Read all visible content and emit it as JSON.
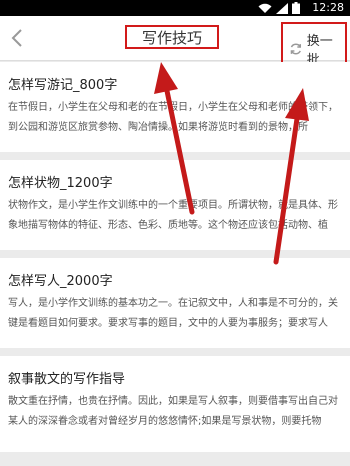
{
  "status": {
    "time": "12:28"
  },
  "header": {
    "title": "写作技巧",
    "refresh_label": "换一批"
  },
  "articles": [
    {
      "title": "怎样写游记_800字",
      "desc": "在节假日，小学生在父母和老的在节假日，小学生在父母和老师的带领下，到公园和游览区旅赏参物、陶冶情操。如果将游览时看到的景物，所"
    },
    {
      "title": "怎样状物_1200字",
      "desc": "状物作文，是小学生作文训练中的一个重要项目。所谓状物，就是具体、形象地描写物体的特征、形态、色彩、质地等。这个物还应该包括动物、植"
    },
    {
      "title": "怎样写人_2000字",
      "desc": "写人，是小学作文训练的基本功之一。在记叙文中，人和事是不可分的，关键是看题目如何要求。要求写事的题目，文中的人要为事服务；要求写人"
    },
    {
      "title": "叙事散文的写作指导",
      "desc": "散文重在抒情，也贵在抒情。因此，如果是写人叙事，则要借事写出自己对某人的深深眷念或者对曾经岁月的悠悠情怀;如果是写景状物，则要托物"
    }
  ]
}
